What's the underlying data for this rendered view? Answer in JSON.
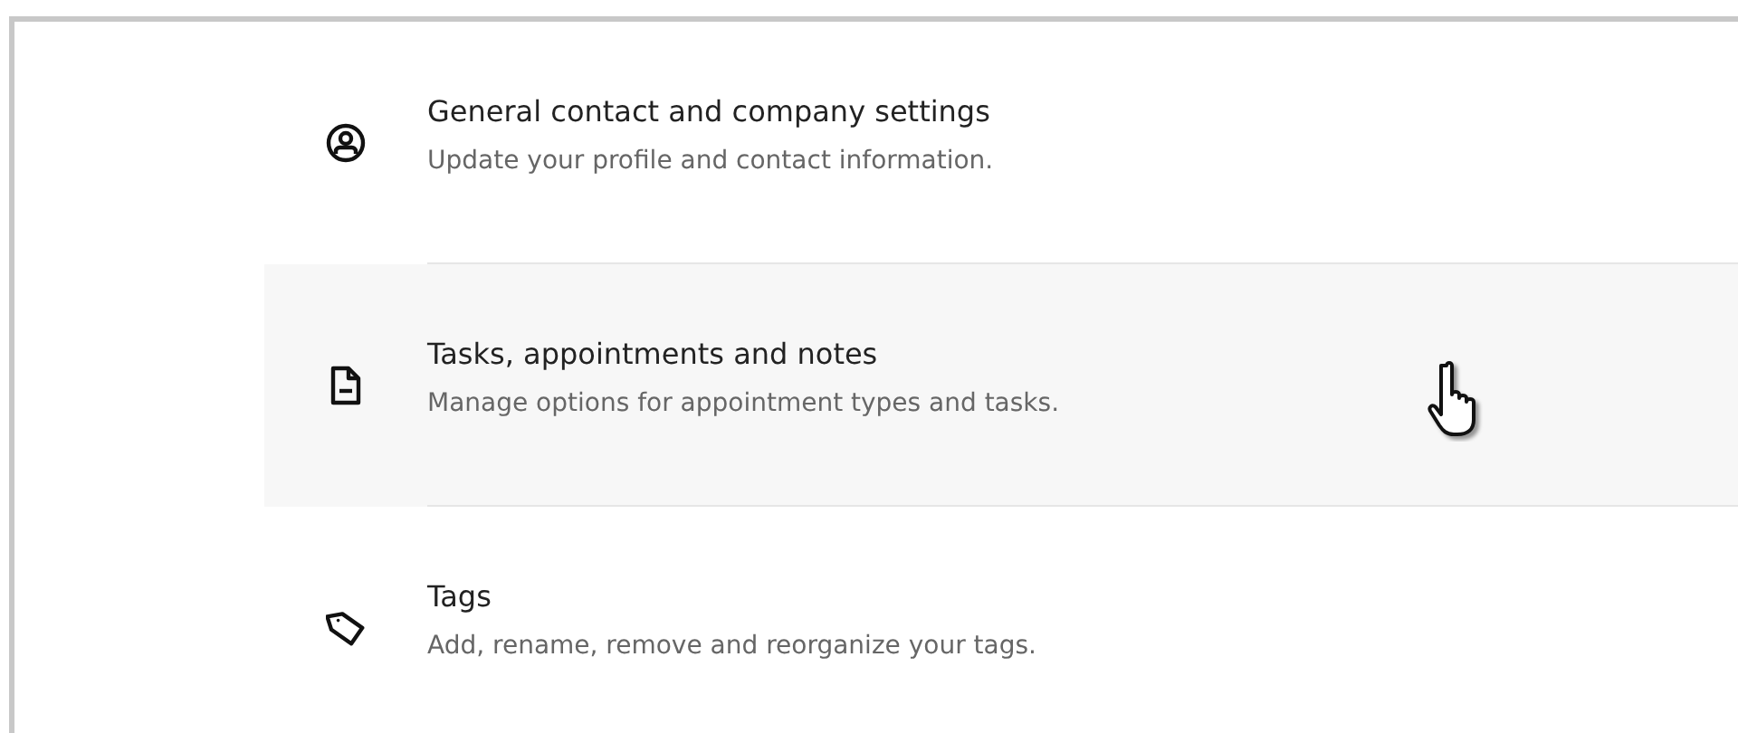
{
  "settings": [
    {
      "kind": "person",
      "title": "General contact and company settings",
      "description": "Update your profile and contact information.",
      "hovered": false
    },
    {
      "kind": "document",
      "title": "Tasks, appointments and notes",
      "description": "Manage options for appointment types and tasks.",
      "hovered": true
    },
    {
      "kind": "tag",
      "title": "Tags",
      "description": "Add, rename, remove and reorganize your tags.",
      "hovered": false
    }
  ]
}
